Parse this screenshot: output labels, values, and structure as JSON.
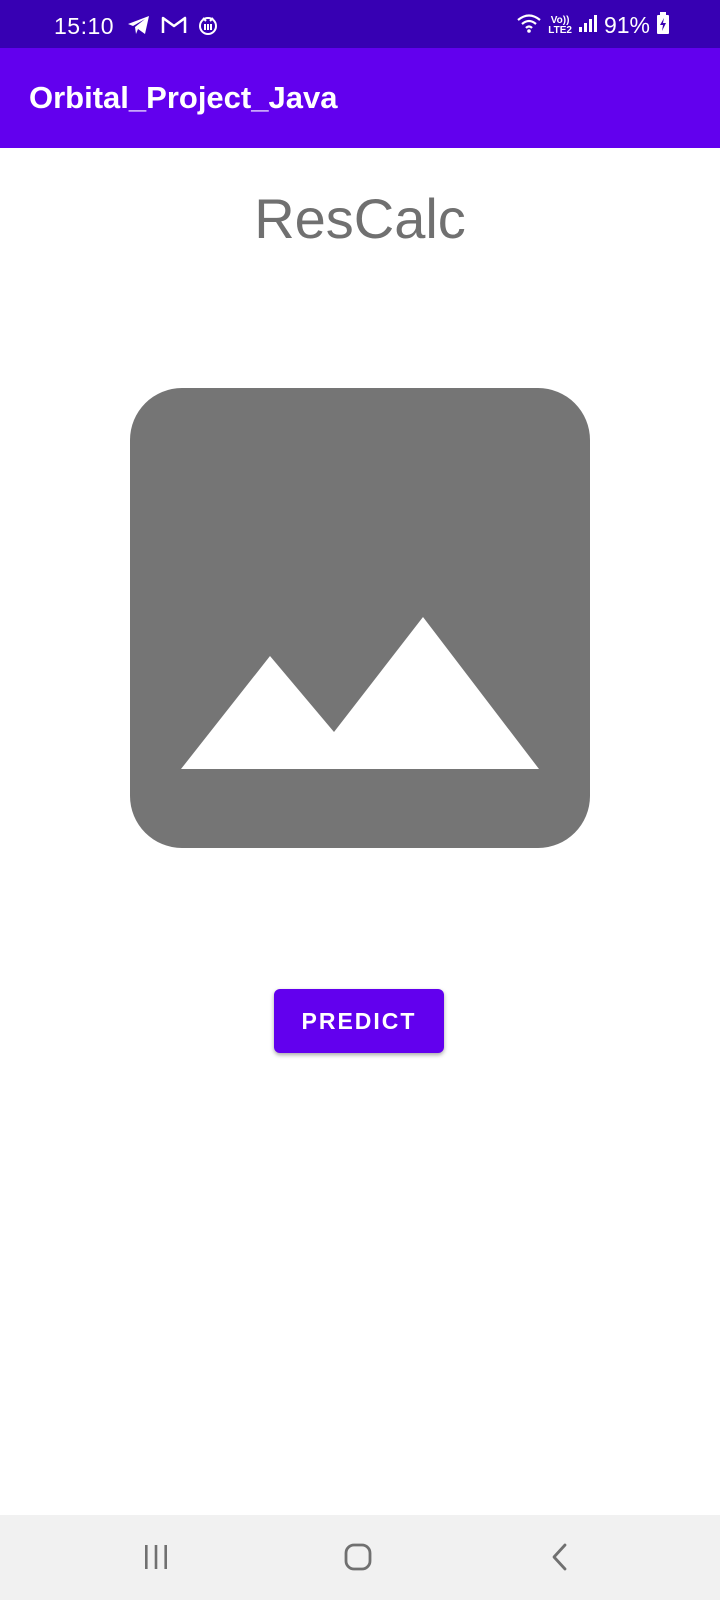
{
  "status_bar": {
    "time": "15:10",
    "volte_top": "Vo))",
    "volte_bottom": "LTE2",
    "battery": "91%"
  },
  "app_bar": {
    "title": "Orbital_Project_Java"
  },
  "main": {
    "title": "ResCalc",
    "predict_label": "PREDICT"
  },
  "icons": {
    "left_status": [
      "telegram-icon",
      "gmail-icon",
      "app-notification-icon"
    ],
    "right_status": [
      "wifi-icon",
      "volte-icon",
      "signal-icon",
      "battery-icon"
    ],
    "placeholder": "image-placeholder-icon",
    "nav": [
      "recents-icon",
      "home-icon",
      "back-icon"
    ]
  },
  "colors": {
    "status_bar": "#3700b3",
    "primary": "#6200ee",
    "placeholder": "#757575",
    "title_text": "#707070",
    "nav_bar": "#f1f1f1"
  }
}
